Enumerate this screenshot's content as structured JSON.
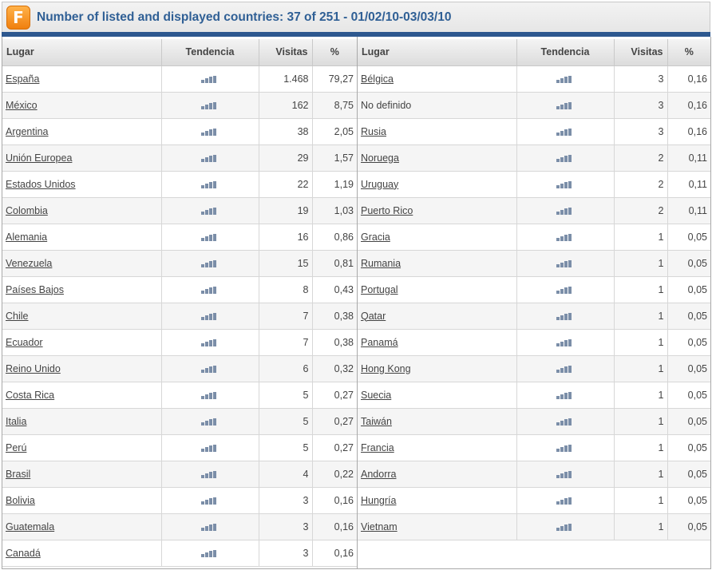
{
  "header": {
    "title": "Number of listed and displayed countries: 37 of 251 - 01/02/10-03/03/10",
    "logo_letter": "F"
  },
  "columns": {
    "place": "Lugar",
    "trend": "Tendencia",
    "visits": "Visitas",
    "percent": "%"
  },
  "rows_left": [
    {
      "place": "España",
      "visits": "1.468",
      "percent": "79,27",
      "link": true
    },
    {
      "place": "México",
      "visits": "162",
      "percent": "8,75",
      "link": true
    },
    {
      "place": "Argentina",
      "visits": "38",
      "percent": "2,05",
      "link": true
    },
    {
      "place": "Unión Europea",
      "visits": "29",
      "percent": "1,57",
      "link": true
    },
    {
      "place": "Estados Unidos",
      "visits": "22",
      "percent": "1,19",
      "link": true
    },
    {
      "place": "Colombia",
      "visits": "19",
      "percent": "1,03",
      "link": true
    },
    {
      "place": "Alemania",
      "visits": "16",
      "percent": "0,86",
      "link": true
    },
    {
      "place": "Venezuela",
      "visits": "15",
      "percent": "0,81",
      "link": true
    },
    {
      "place": "Países Bajos",
      "visits": "8",
      "percent": "0,43",
      "link": true
    },
    {
      "place": "Chile",
      "visits": "7",
      "percent": "0,38",
      "link": true
    },
    {
      "place": "Ecuador",
      "visits": "7",
      "percent": "0,38",
      "link": true
    },
    {
      "place": "Reino Unido",
      "visits": "6",
      "percent": "0,32",
      "link": true
    },
    {
      "place": "Costa Rica",
      "visits": "5",
      "percent": "0,27",
      "link": true
    },
    {
      "place": "Italia",
      "visits": "5",
      "percent": "0,27",
      "link": true
    },
    {
      "place": "Perú",
      "visits": "5",
      "percent": "0,27",
      "link": true
    },
    {
      "place": "Brasil",
      "visits": "4",
      "percent": "0,22",
      "link": true
    },
    {
      "place": "Bolivia",
      "visits": "3",
      "percent": "0,16",
      "link": true
    },
    {
      "place": "Guatemala",
      "visits": "3",
      "percent": "0,16",
      "link": true
    },
    {
      "place": "Canadá",
      "visits": "3",
      "percent": "0,16",
      "link": true
    }
  ],
  "rows_right": [
    {
      "place": "Bélgica",
      "visits": "3",
      "percent": "0,16",
      "link": true
    },
    {
      "place": "No definido",
      "visits": "3",
      "percent": "0,16",
      "link": false
    },
    {
      "place": "Rusia",
      "visits": "3",
      "percent": "0,16",
      "link": true
    },
    {
      "place": "Noruega",
      "visits": "2",
      "percent": "0,11",
      "link": true
    },
    {
      "place": "Uruguay",
      "visits": "2",
      "percent": "0,11",
      "link": true
    },
    {
      "place": "Puerto Rico",
      "visits": "2",
      "percent": "0,11",
      "link": true
    },
    {
      "place": "Gracia",
      "visits": "1",
      "percent": "0,05",
      "link": true
    },
    {
      "place": "Rumania",
      "visits": "1",
      "percent": "0,05",
      "link": true
    },
    {
      "place": "Portugal",
      "visits": "1",
      "percent": "0,05",
      "link": true
    },
    {
      "place": "Qatar",
      "visits": "1",
      "percent": "0,05",
      "link": true
    },
    {
      "place": "Panamá",
      "visits": "1",
      "percent": "0,05",
      "link": true
    },
    {
      "place": "Hong Kong",
      "visits": "1",
      "percent": "0,05",
      "link": true
    },
    {
      "place": "Suecia",
      "visits": "1",
      "percent": "0,05",
      "link": true
    },
    {
      "place": "Taiwán",
      "visits": "1",
      "percent": "0,05",
      "link": true
    },
    {
      "place": "Francia",
      "visits": "1",
      "percent": "0,05",
      "link": true
    },
    {
      "place": "Andorra",
      "visits": "1",
      "percent": "0,05",
      "link": true
    },
    {
      "place": "Hungría",
      "visits": "1",
      "percent": "0,05",
      "link": true
    },
    {
      "place": "Vietnam",
      "visits": "1",
      "percent": "0,05",
      "link": true
    }
  ],
  "icons": {
    "logo": "f-logo-icon",
    "trend": "trend-bars-icon"
  },
  "colors": {
    "title": "#2f5f95",
    "accent_bar": "#2d588f",
    "logo": "#f39423",
    "trend_icon": "#7b8ea8"
  }
}
